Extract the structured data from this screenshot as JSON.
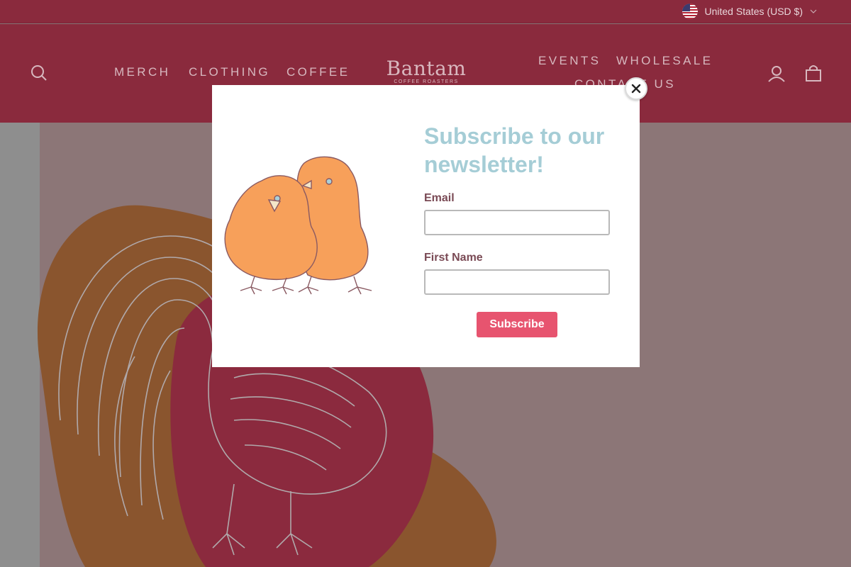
{
  "topbar": {
    "currency_label": "United States (USD $)",
    "flag_icon": "us-flag-icon"
  },
  "header": {
    "search_icon": "search-icon",
    "nav_left": [
      "MERCH",
      "CLOTHING",
      "COFFEE"
    ],
    "logo": {
      "name": "Bantam",
      "tagline": "COFFEE ROASTERS"
    },
    "nav_right": [
      "EVENTS",
      "WHOLESALE",
      "CONTACT US"
    ],
    "account_icon": "user-icon",
    "cart_icon": "cart-icon",
    "colors": {
      "background": "#8a2a3d",
      "nav_text": "#d7b8bf"
    }
  },
  "hero": {
    "colors": {
      "background": "#8c7677",
      "orange_shape": "#8a552e",
      "red_shape": "#8b2a3e",
      "line_art": "#b0a9ab",
      "left_strip": "#8e8e8e"
    }
  },
  "newsletter": {
    "title": "Subscribe to our newsletter!",
    "email_label": "Email",
    "email_value": "",
    "first_name_label": "First Name",
    "first_name_value": "",
    "subscribe_label": "Subscribe",
    "close_icon": "close-icon",
    "colors": {
      "title": "#a5cdd6",
      "label": "#7a4a55",
      "button": "#e7546f",
      "chick_fill": "#f7a05a"
    }
  }
}
